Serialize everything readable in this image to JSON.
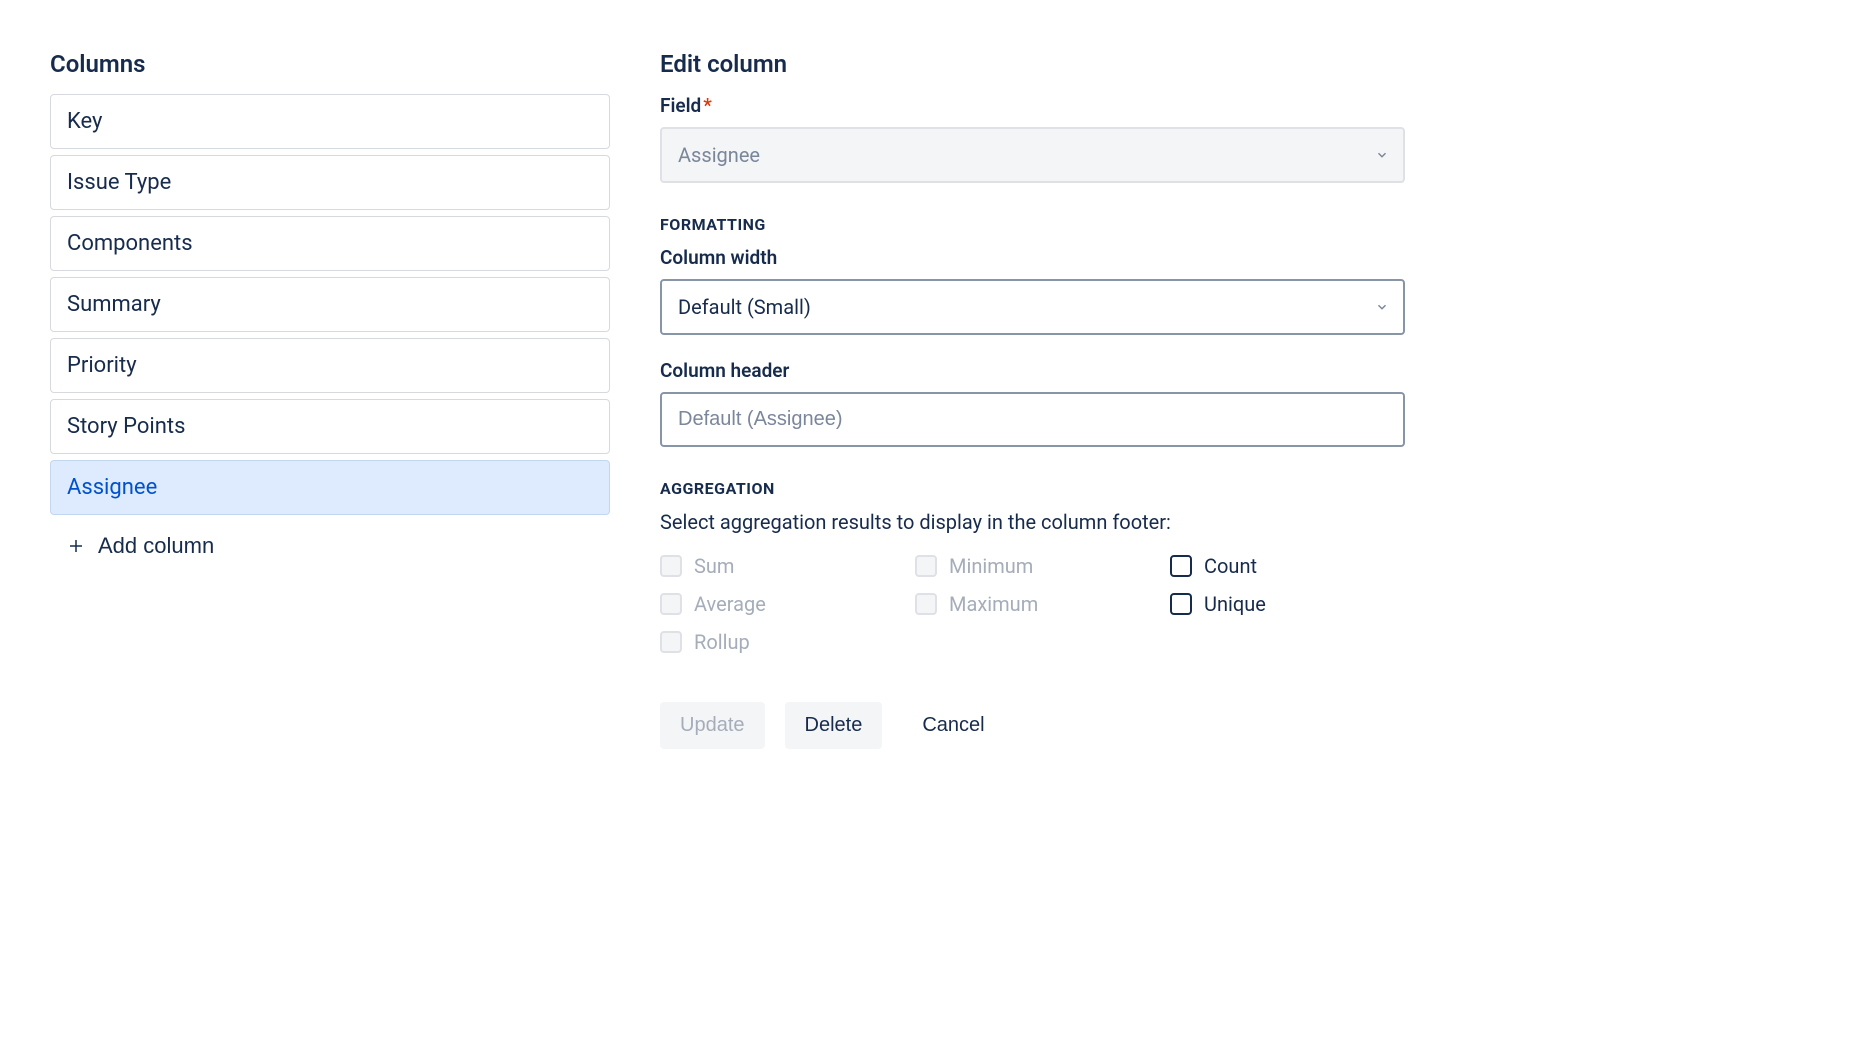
{
  "left": {
    "title": "Columns",
    "items": [
      {
        "label": "Key",
        "selected": false
      },
      {
        "label": "Issue Type",
        "selected": false
      },
      {
        "label": "Components",
        "selected": false
      },
      {
        "label": "Summary",
        "selected": false
      },
      {
        "label": "Priority",
        "selected": false
      },
      {
        "label": "Story Points",
        "selected": false
      },
      {
        "label": "Assignee",
        "selected": true
      }
    ],
    "add_column_label": "Add column"
  },
  "right": {
    "title": "Edit column",
    "field": {
      "label": "Field",
      "value": "Assignee"
    },
    "formatting": {
      "header": "FORMATTING",
      "width_label": "Column width",
      "width_value": "Default (Small)",
      "header_label": "Column header",
      "header_placeholder": "Default (Assignee)"
    },
    "aggregation": {
      "header": "AGGREGATION",
      "helper": "Select aggregation results to display in the column footer:",
      "options": [
        {
          "label": "Sum",
          "enabled": false
        },
        {
          "label": "Minimum",
          "enabled": false
        },
        {
          "label": "Count",
          "enabled": true
        },
        {
          "label": "Average",
          "enabled": false
        },
        {
          "label": "Maximum",
          "enabled": false
        },
        {
          "label": "Unique",
          "enabled": true
        },
        {
          "label": "Rollup",
          "enabled": false
        }
      ]
    },
    "buttons": {
      "update": "Update",
      "delete": "Delete",
      "cancel": "Cancel"
    }
  }
}
